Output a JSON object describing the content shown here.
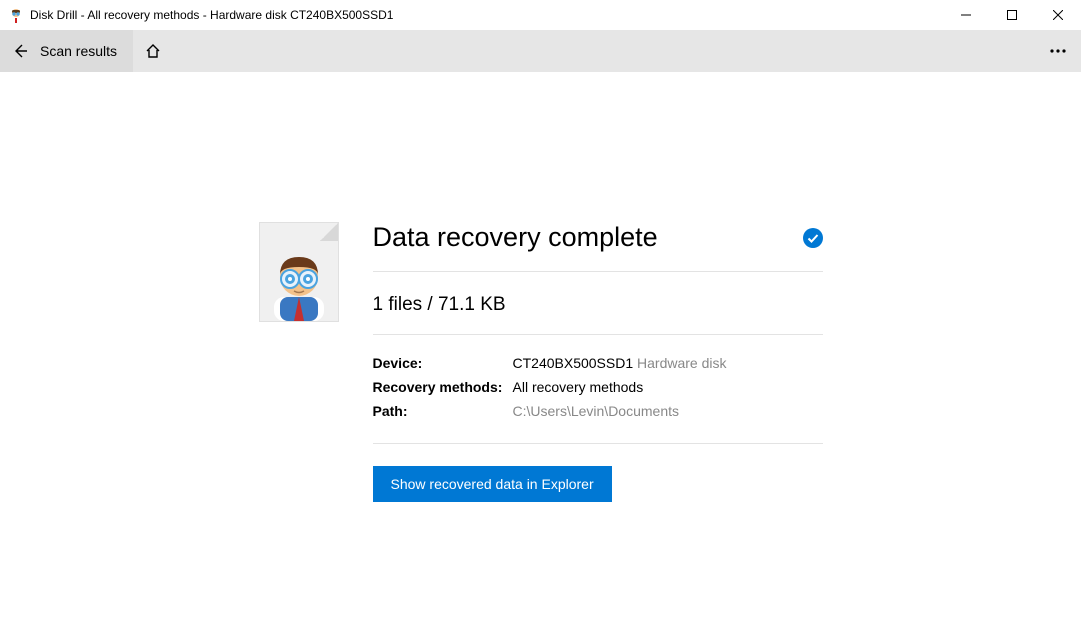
{
  "window": {
    "title": "Disk Drill - All recovery methods - Hardware disk CT240BX500SSD1"
  },
  "toolbar": {
    "scan_results": "Scan results"
  },
  "main": {
    "heading": "Data recovery complete",
    "summary": "1 files / 71.1 KB",
    "device_label": "Device:",
    "device_value": "CT240BX500SSD1",
    "device_type": "Hardware disk",
    "methods_label": "Recovery methods:",
    "methods_value": "All recovery methods",
    "path_label": "Path:",
    "path_value": "C:\\Users\\Levin\\Documents",
    "action_button": "Show recovered data in Explorer"
  }
}
